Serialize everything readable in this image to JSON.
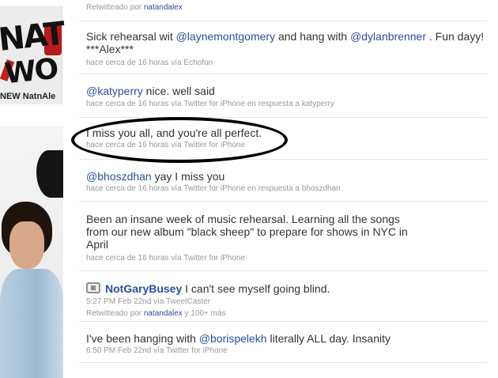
{
  "banner": {
    "logo_line1": "NAT&",
    "logo_line2": "WO",
    "subtitle": "NEW NatnAle"
  },
  "tweets": [
    {
      "meta_prefix": "Retwitteado por",
      "retweeter": "natandalex"
    },
    {
      "text_a": "Sick rehearsal wit ",
      "mention_1": "@laynemontgomery",
      "text_b": " and hang with ",
      "mention_2": "@dylanbrenner",
      "text_c": " . Fun dayy! ***Alex***",
      "meta": "hace cerca de 16 horas vía Echofon"
    },
    {
      "mention": "@katyperry",
      "text": " nice. well said",
      "meta": "hace cerca de 16 horas vía Twitter for iPhone en respuesta a katyperry"
    },
    {
      "text": "I miss you all, and you're all perfect.",
      "meta": "hace cerca de 16 horas vía Twitter for iPhone"
    },
    {
      "mention": "@bhoszdhan",
      "text": " yay I miss you",
      "meta": "hace cerca de 16 horas vía Twitter for iPhone en respuesta a bhoszdhan"
    },
    {
      "line1": "Been an insane week of music rehearsal. Learning all the songs",
      "line2": "from our new album \"black sheep\" to prepare for shows in NYC in",
      "line3": "April",
      "meta": "hace cerca de 16 horas vía Twitter for iPhone"
    },
    {
      "user": "NotGaryBusey",
      "text": " I can't see myself going blind.",
      "meta": "5:27 PM Feb 22nd vía TweetCaster",
      "rt_prefix": "Retwitteado por",
      "retweeter": "natandalex",
      "rt_suffix": " y 100+ más"
    },
    {
      "text_a": "I've been hanging with ",
      "mention": "@borispelekh",
      "text_b": " literally ALL day. Insanity",
      "meta": "6:50 PM Feb 22nd vía Twitter for iPhone"
    }
  ],
  "colors": {
    "link": "#2b4f9c",
    "text": "#333333",
    "meta": "#999999",
    "highlight_ellipse": "#000000"
  }
}
